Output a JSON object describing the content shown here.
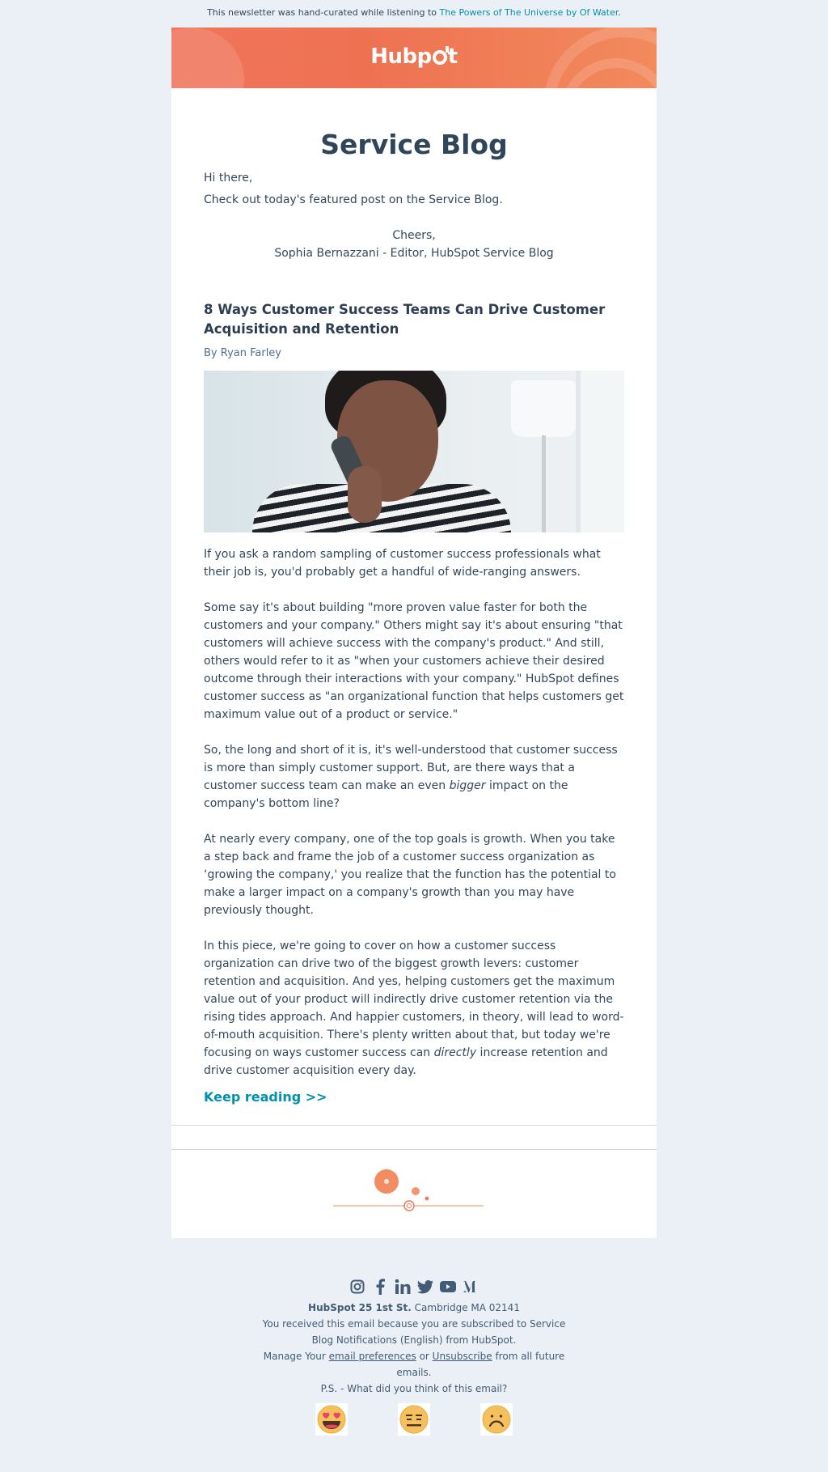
{
  "preheader": {
    "text": "This newsletter was hand-curated while listening to ",
    "link": "The Powers of The Universe by Of Water",
    "end": "."
  },
  "banner": {
    "logo_text_1": "Hub",
    "logo_text_2": "p",
    "logo_text_3": "t"
  },
  "blog_title": "Service Blog",
  "greeting": "Hi there,",
  "intro": "Check out today's featured post on the Service Blog.",
  "signoff": {
    "cheers": "Cheers,",
    "signature": "Sophia Bernazzani - Editor, HubSpot Service Blog"
  },
  "post": {
    "title": "8 Ways Customer Success Teams Can Drive Customer Acquisition and Retention",
    "byline": "By Ryan Farley",
    "p1": "If you ask a random sampling of customer success professionals what their job is, you'd probably get a handful of wide-ranging answers.",
    "p2": "Some say it's about building \"more proven value faster for both the customers and your company.\" Others might say it's about ensuring \"that customers will achieve success with the company's product.\" And still, others would refer to it as \"when your customers achieve their desired outcome through their interactions with your company.\" HubSpot defines customer success as \"an organizational function that helps customers get maximum value out of a product or service.\"",
    "p3_a": "So, the long and short of it is, it's well-understood that customer success is more than simply customer support. But, are there ways that a customer success team can make an even ",
    "p3_em": "bigger",
    "p3_b": " impact on the company's bottom line?",
    "p4": "At nearly every company, one of the top goals is growth. When you take a step back and frame the job of a customer success organization as ‘growing the company,' you realize that the function has the potential to make a larger impact on a company's growth than you may have previously thought.",
    "p5_a": "In this piece, we're going to cover on how a customer success organization can drive two of the biggest growth levers: customer retention and acquisition. And yes, helping customers get the maximum value out of your product will indirectly drive customer retention via the rising tides approach. And happier customers, in theory, will lead to word-of-mouth acquisition. There's plenty written about that, but today we're focusing on ways customer success can ",
    "p5_em": "directly",
    "p5_b": " increase retention and drive customer acquisition every day.",
    "keep_reading": "Keep reading >>"
  },
  "footer": {
    "social_icons": [
      "instagram-icon",
      "facebook-icon",
      "linkedin-icon",
      "twitter-icon",
      "youtube-icon",
      "medium-icon"
    ],
    "company": "HubSpot 25 1st St.",
    "city": " Cambridge MA 02141",
    "reason": "You received this email because you are subscribed to Service Blog Notifications (English) from HubSpot.",
    "manage_prefix": "Manage Your ",
    "prefs_link": "email preferences",
    "or": " or ",
    "unsub_link": "Unsubscribe",
    "manage_suffix": " from all future emails.",
    "ps": "P.S. - What did you think of this email?",
    "feedback": [
      "heart-eyes-emoji",
      "neutral-emoji",
      "frown-emoji"
    ]
  },
  "colors": {
    "accent": "#0091ae",
    "banner": "#ee7252",
    "text": "#33475b",
    "background": "#eaf0f6"
  }
}
